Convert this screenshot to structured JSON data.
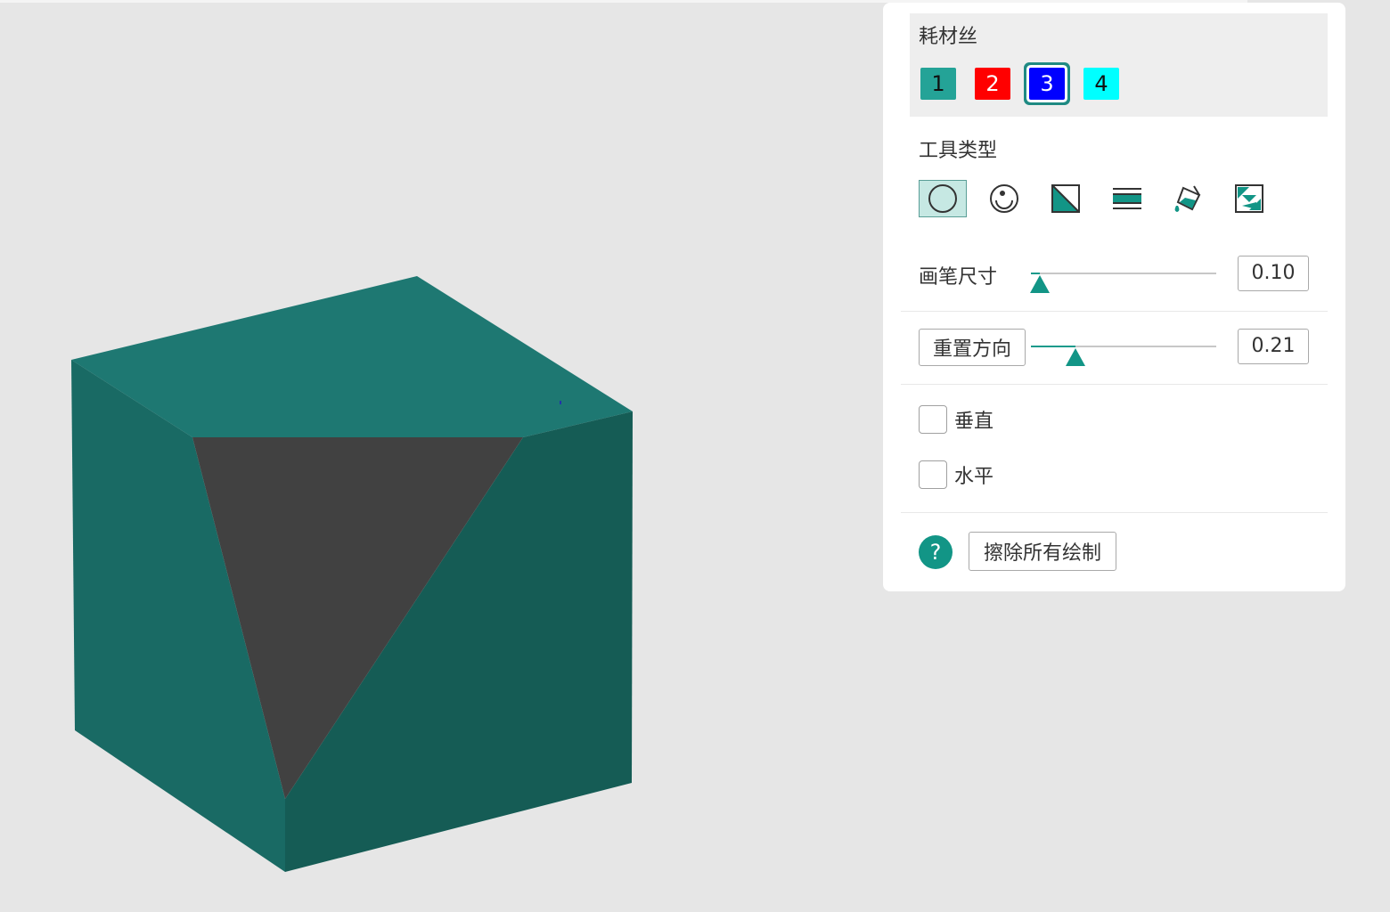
{
  "filament": {
    "title": "耗材丝",
    "swatches": [
      {
        "label": "1",
        "color": "#24a397",
        "text_color": "#111111"
      },
      {
        "label": "2",
        "color": "#ff0000",
        "text_color": "#ffffff"
      },
      {
        "label": "3",
        "color": "#0000ff",
        "text_color": "#ffffff",
        "selected": true
      },
      {
        "label": "4",
        "color": "#00ffff",
        "text_color": "#111111"
      }
    ]
  },
  "tools": {
    "title": "工具类型",
    "items": [
      {
        "icon": "circle-brush-icon",
        "active": true
      },
      {
        "icon": "sphere-brush-icon",
        "active": false
      },
      {
        "icon": "triangle-fill-icon",
        "active": false
      },
      {
        "icon": "height-range-icon",
        "active": false
      },
      {
        "icon": "fill-bucket-icon",
        "active": false
      },
      {
        "icon": "gap-fill-icon",
        "active": false
      }
    ]
  },
  "brush_size": {
    "label": "画笔尺寸",
    "value": "0.10",
    "fraction": 0.05
  },
  "reset_direction": {
    "label": "重置方向",
    "value": "0.21",
    "fraction": 0.24
  },
  "vertical": {
    "label": "垂直",
    "checked": false
  },
  "horizontal": {
    "label": "水平",
    "checked": false
  },
  "erase_all": {
    "label": "擦除所有绘制"
  },
  "help": {
    "glyph": "?"
  },
  "colors": {
    "accent": "#129586",
    "cube_top": "#1e7872",
    "cube_left": "#196a64",
    "cube_right": "#155c55",
    "cube_cut": "#414141",
    "background": "#e6e6e6"
  }
}
